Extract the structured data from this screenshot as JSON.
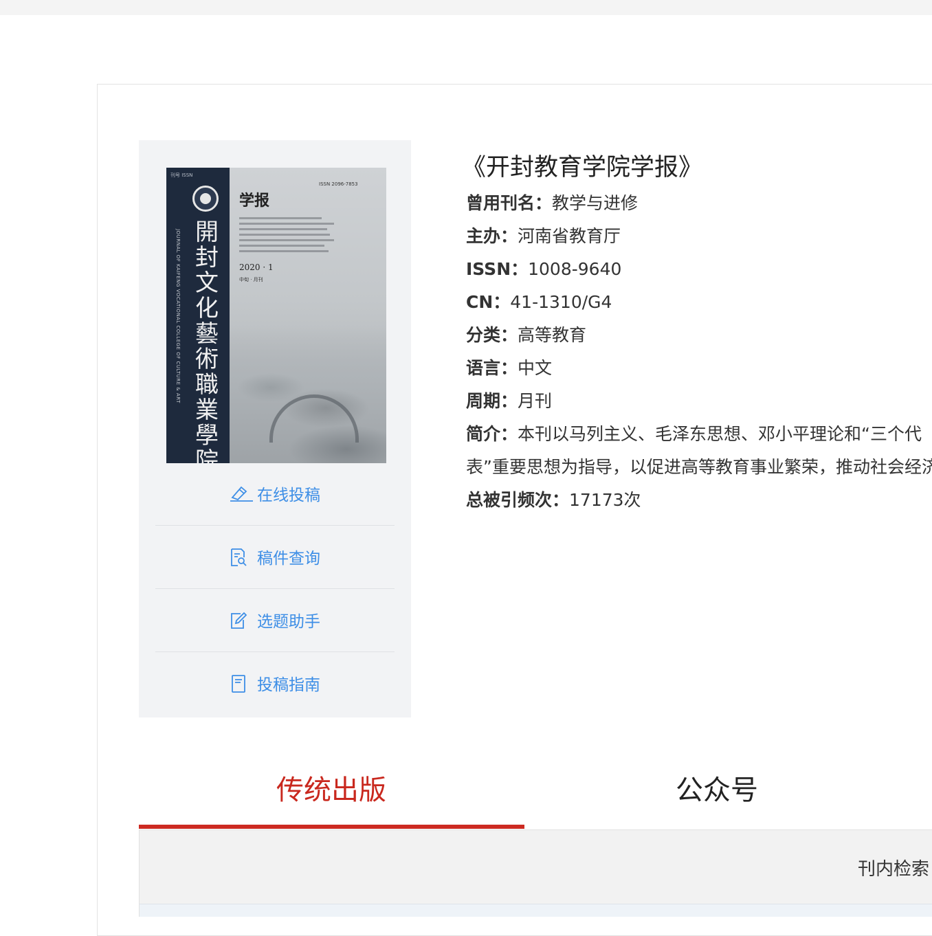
{
  "journal": {
    "title": "《开封教育学院学报》",
    "cover": {
      "corner_tag": "刊号 ISSN",
      "vertical_name": [
        "開",
        "封",
        "文",
        "化",
        "藝",
        "術",
        "職",
        "業",
        "學",
        "院"
      ],
      "english_name": "JOURNAL OF KAIFENG VOCATIONAL COLLEGE OF CULTURE & ART",
      "title": "学报",
      "issn": "ISSN 2096-7853",
      "issue": "2020 · 1",
      "sub": "中旬 · 月刊"
    },
    "fields": [
      {
        "key": "曾用刊名：",
        "value": "教学与进修"
      },
      {
        "key": "主办：",
        "value": "河南省教育厅"
      },
      {
        "key": "ISSN：",
        "value": "1008-9640"
      },
      {
        "key": "CN：",
        "value": "41-1310/G4"
      },
      {
        "key": "分类：",
        "value": "高等教育"
      },
      {
        "key": "语言：",
        "value": "中文"
      },
      {
        "key": "周期：",
        "value": "月刊"
      }
    ],
    "intro": {
      "key": "简介：",
      "value": "本刊以马列主义、毛泽东思想、邓小平理论和“三个代表”重要思想为指导，以促进高等教育事业繁荣，推动社会经济全面发展，全面建设小康社会为宗旨……"
    },
    "citations": {
      "key": "总被引频次：",
      "value": "17173次"
    }
  },
  "sidebar": {
    "actions": [
      {
        "label": "在线投稿",
        "icon": "submit-pen-icon"
      },
      {
        "label": "稿件查询",
        "icon": "document-search-icon"
      },
      {
        "label": "选题助手",
        "icon": "edit-note-icon"
      },
      {
        "label": "投稿指南",
        "icon": "guide-book-icon"
      }
    ]
  },
  "tabs": [
    {
      "label": "传统出版",
      "active": true
    },
    {
      "label": "公众号",
      "active": false
    }
  ],
  "search": {
    "label": "刊内检索"
  },
  "colors": {
    "accent_red": "#c9281e",
    "link_blue": "#3d8ee6"
  }
}
